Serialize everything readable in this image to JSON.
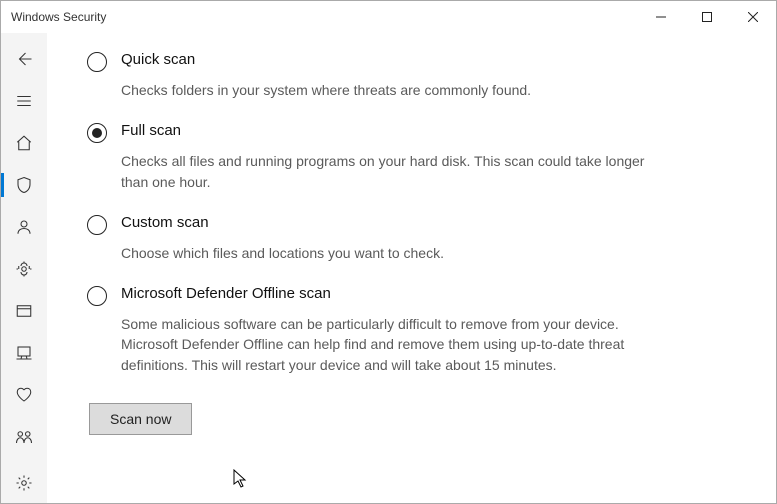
{
  "window": {
    "title": "Windows Security"
  },
  "options": {
    "quick": {
      "title": "Quick scan",
      "desc": "Checks folders in your system where threats are commonly found."
    },
    "full": {
      "title": "Full scan",
      "desc": "Checks all files and running programs on your hard disk. This scan could take longer than one hour."
    },
    "custom": {
      "title": "Custom scan",
      "desc": "Choose which files and locations you want to check."
    },
    "offline": {
      "title": "Microsoft Defender Offline scan",
      "desc": "Some malicious software can be particularly difficult to remove from your device. Microsoft Defender Offline can help find and remove them using up-to-date threat definitions. This will restart your device and will take about 15 minutes."
    }
  },
  "selected": "full",
  "buttons": {
    "scan_now": "Scan now"
  }
}
